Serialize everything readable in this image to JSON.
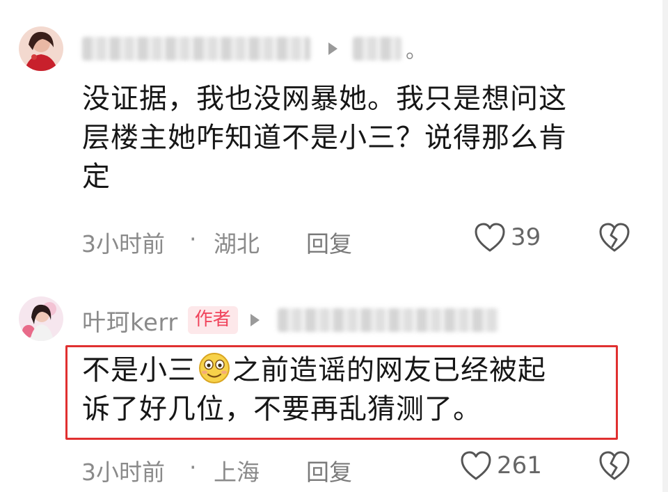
{
  "comments": [
    {
      "author": "",
      "body_lines": [
        "没证据，我也没网暴她。我只是想问这",
        "层楼主她咋知道不是小三？说得那么肯",
        "定"
      ],
      "time": "3小时前",
      "separator": "·",
      "location": "湖北",
      "reply_label": "回复",
      "likes": "39",
      "reply_suffix": "。"
    },
    {
      "author": "叶珂kerr",
      "badge": "作者",
      "body_line1_a": "不是小三",
      "body_line1_b": "之前造谣的网友已经被起",
      "body_line2": "诉了好几位，不要再乱猜测了。",
      "time": "3小时前",
      "separator": "·",
      "location": "上海",
      "reply_label": "回复",
      "likes": "261"
    }
  ],
  "icons": {
    "like": "heart-outline-icon",
    "dislike": "broken-heart-icon",
    "arrow": "caret-right-icon",
    "emoji": "smiling-face-icon"
  },
  "colors": {
    "badge_bg": "#fde8ea",
    "badge_text": "#f0445c",
    "highlight_border": "#e03030",
    "meta_text": "#8a8a8a"
  }
}
